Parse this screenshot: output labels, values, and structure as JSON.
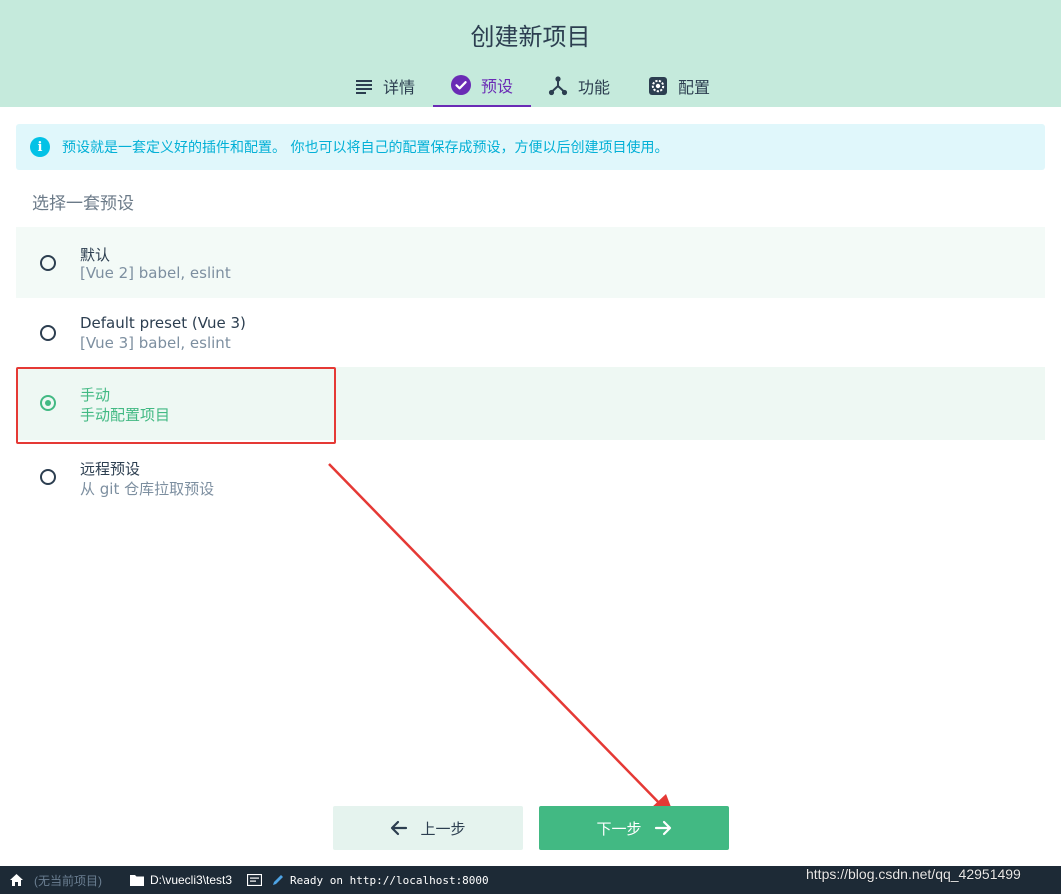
{
  "header": {
    "title": "创建新项目",
    "tabs": [
      {
        "label": "详情",
        "icon": "details-list-icon",
        "active": false
      },
      {
        "label": "预设",
        "icon": "check-circle-icon",
        "active": true
      },
      {
        "label": "功能",
        "icon": "features-branch-icon",
        "active": false
      },
      {
        "label": "配置",
        "icon": "gear-icon",
        "active": false
      }
    ]
  },
  "info": {
    "icon": "info-icon",
    "text": "预设就是一套定义好的插件和配置。 你也可以将自己的配置保存成预设，方便以后创建项目使用。"
  },
  "presets": {
    "title": "选择一套预设",
    "items": [
      {
        "name": "默认",
        "desc": "[Vue 2] babel, eslint",
        "selected": false
      },
      {
        "name": "Default preset (Vue 3)",
        "desc": "[Vue 3] babel, eslint",
        "selected": false
      },
      {
        "name": "手动",
        "desc": "手动配置项目",
        "selected": true
      },
      {
        "name": "远程预设",
        "desc": "从 git 仓库拉取预设",
        "selected": false
      }
    ]
  },
  "actions": {
    "prev_label": "上一步",
    "next_label": "下一步"
  },
  "statusbar": {
    "no_project": "(无当前项目)",
    "path": "D:\\vuecli3\\test3",
    "server_status": "Ready on http://localhost:8000",
    "watermark": "https://blog.csdn.net/qq_42951499"
  },
  "colors": {
    "header_bg": "#c5eadc",
    "accent_green": "#42b983",
    "tab_active": "#6a2bb5",
    "info_bg": "#e0f7fb",
    "info_text": "#03b0d6",
    "annotation_red": "#e53935",
    "statusbar_bg": "#1d2a36"
  }
}
